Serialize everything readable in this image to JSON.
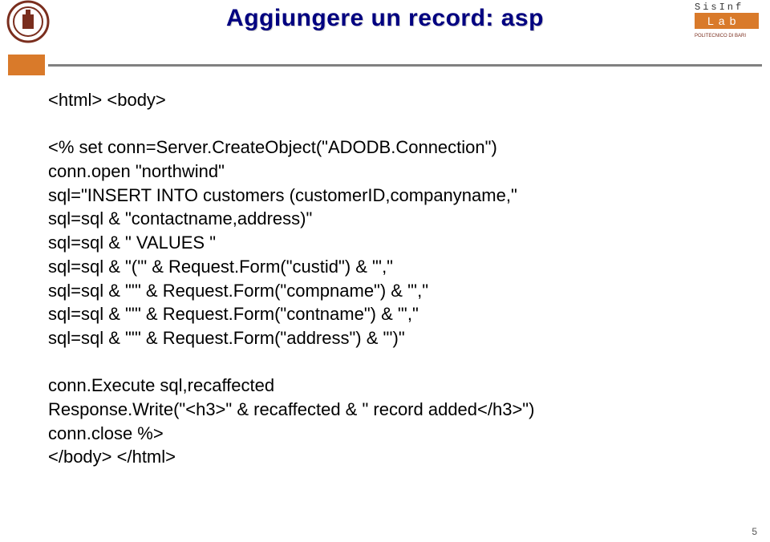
{
  "header": {
    "title": "Aggiungere un record: asp",
    "lab_top": "S i s I n f",
    "lab_mid": "L  a  b",
    "lab_bottom": "POLITECNICO DI BARI"
  },
  "code": {
    "l1": "<html> <body>",
    "l2": "",
    "l3": "<% set conn=Server.CreateObject(\"ADODB.Connection\")",
    "l4": "conn.open \"northwind\"",
    "l5": "sql=\"INSERT INTO customers (customerID,companyname,\"",
    "l6": "sql=sql & \"contactname,address)\"",
    "l7": "sql=sql & \" VALUES \"",
    "l8": "sql=sql & \"('\" & Request.Form(\"custid\") & \"',\"",
    "l9": "sql=sql & \"'\" & Request.Form(\"compname\") & \"',\"",
    "l10": "sql=sql & \"'\" & Request.Form(\"contname\") & \"',\"",
    "l11": "sql=sql & \"'\" & Request.Form(\"address\") & \"')\"",
    "l12": "",
    "l13": "conn.Execute sql,recaffected",
    "l14": "Response.Write(\"<h3>\" & recaffected & \" record added</h3>\")",
    "l15": "conn.close %>",
    "l16": "</body> </html>"
  },
  "page": "5"
}
